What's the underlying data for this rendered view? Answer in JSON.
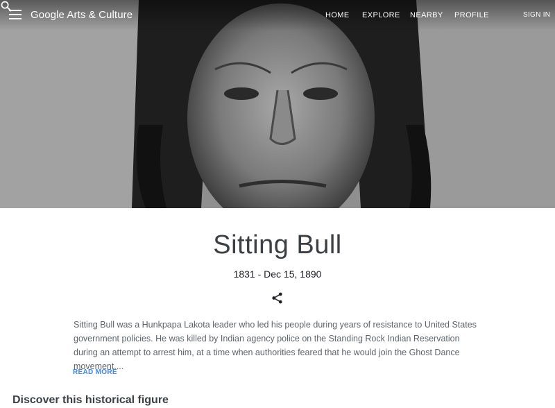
{
  "header": {
    "logo": "Google Arts & Culture",
    "nav": [
      "HOME",
      "EXPLORE",
      "NEARBY",
      "PROFILE"
    ],
    "signin": "SIGN IN",
    "icons": [
      "menu-icon",
      "search-icon"
    ]
  },
  "hero": {
    "image": "portrait-photo"
  },
  "figure": {
    "name": "Sitting Bull",
    "dates": "1831 - Dec 15, 1890",
    "description": "Sitting Bull was a Hunkpapa Lakota leader who led his people during years of resistance to United States government policies. He was killed by Indian agency police on the Standing Rock Indian Reservation during an attempt to arrest him, at a time when authorities feared that he would join the Ghost Dance movement....",
    "read_more": "READ MORE",
    "share_icon": "share-icon"
  },
  "discover": {
    "title": "Discover this historical figure"
  }
}
